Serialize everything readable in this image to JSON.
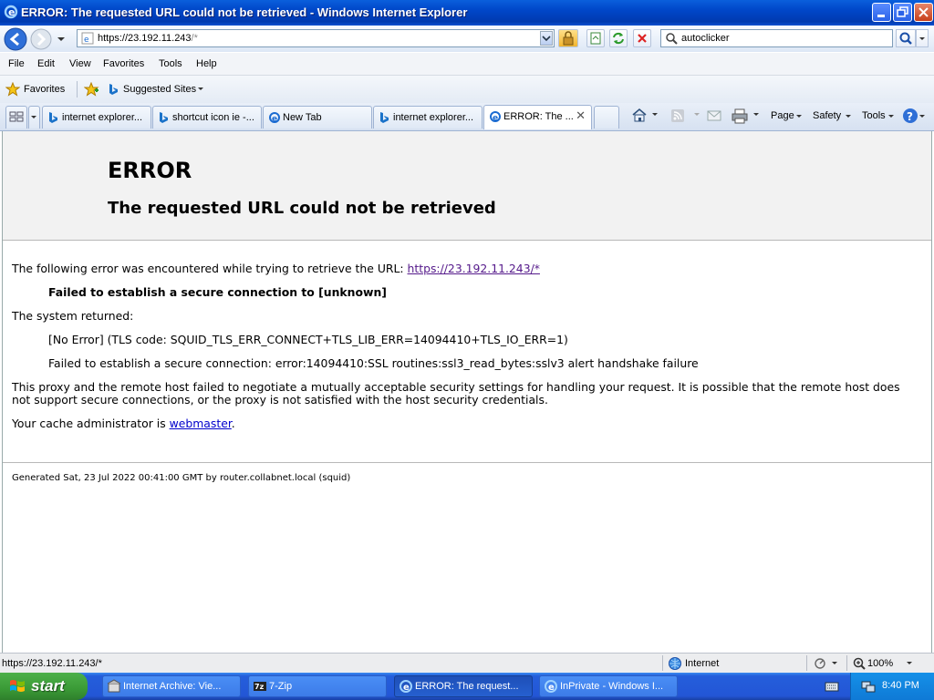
{
  "window": {
    "title": "ERROR: The requested URL could not be retrieved - Windows Internet Explorer"
  },
  "nav": {
    "address_host": "https://23.192.11.243",
    "address_rest": "/*",
    "search_value": "autoclicker"
  },
  "menu": [
    "File",
    "Edit",
    "View",
    "Favorites",
    "Tools",
    "Help"
  ],
  "favorites_bar": {
    "favorites_label": "Favorites",
    "suggested_label": "Suggested Sites"
  },
  "tabs": [
    {
      "label": "internet explorer...",
      "icon": "bing-icon"
    },
    {
      "label": "shortcut icon ie -...",
      "icon": "bing-icon"
    },
    {
      "label": "New Tab",
      "icon": "ie-icon"
    },
    {
      "label": "internet explorer...",
      "icon": "bing-icon"
    },
    {
      "label": "ERROR: The ...",
      "icon": "ie-icon",
      "active": true
    }
  ],
  "command_bar": {
    "page": "Page",
    "safety": "Safety",
    "tools": "Tools"
  },
  "page": {
    "h1": "ERROR",
    "h2": "The requested URL could not be retrieved",
    "intro": "The following error was encountered while trying to retrieve the URL: ",
    "intro_link": "https://23.192.11.243/*",
    "failed": "Failed to establish a secure connection to [unknown]",
    "returned": "The system returned:",
    "no_error": "[No Error] (TLS code: SQUID_TLS_ERR_CONNECT+TLS_LIB_ERR=14094410+TLS_IO_ERR=1)",
    "ssl_line": "Failed to establish a secure connection: error:14094410:SSL routines:ssl3_read_bytes:sslv3 alert handshake failure",
    "proxy_line1": "This proxy and the remote host failed to negotiate a mutually acceptable security settings for handling your request. It is possible that the remote host does",
    "proxy_line2": "not support secure connections, or the proxy is not satisfied with the host security credentials.",
    "admin_prefix": "Your cache administrator is ",
    "admin_link": "webmaster",
    "admin_suffix": ".",
    "footer": "Generated Sat, 23 Jul 2022 00:41:00 GMT by router.collabnet.local (squid)"
  },
  "status": {
    "url": "https://23.192.11.243/*",
    "zone": "Internet",
    "zoom": "100%"
  },
  "taskbar": {
    "start": "start",
    "items": [
      {
        "label": "Internet Archive: Vie...",
        "active": false
      },
      {
        "label": "7-Zip",
        "active": false
      },
      {
        "label": "ERROR: The request...",
        "active": true
      },
      {
        "label": "InPrivate - Windows I...",
        "active": false
      }
    ],
    "clock": "8:40 PM"
  }
}
